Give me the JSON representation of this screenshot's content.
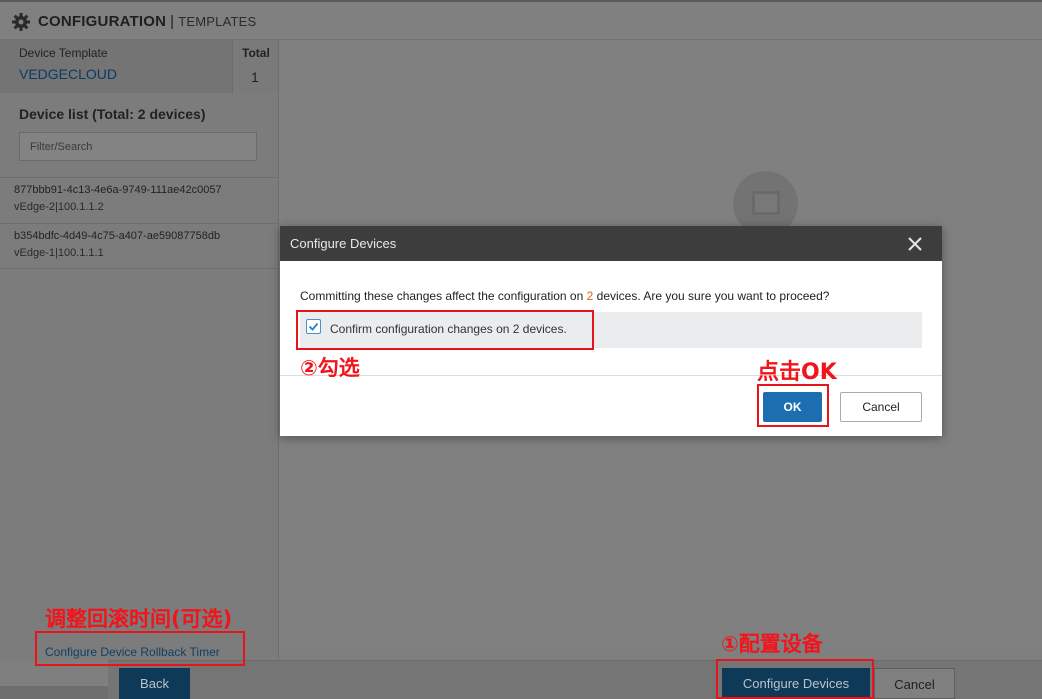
{
  "header": {
    "title": "CONFIGURATION",
    "separator": "|",
    "subtitle": "TEMPLATES",
    "icon": "gear-icon"
  },
  "left_panel": {
    "template_label": "Device Template",
    "template_name": "VEDGECLOUD",
    "total_label": "Total",
    "total_value": "1",
    "device_list_title": "Device list (Total: 2 devices)",
    "filter_placeholder": "Filter/Search",
    "devices": [
      {
        "id": "877bbb91-4c13-4e6a-9749-111ae42c0057",
        "sub": "vEdge-2|100.1.1.2"
      },
      {
        "id": "b354bdfc-4d49-4c75-a407-ae59087758db",
        "sub": "vEdge-1|100.1.1.1"
      }
    ],
    "rollback_link": "Configure Device Rollback Timer"
  },
  "footer": {
    "back_label": "Back",
    "configure_label": "Configure Devices",
    "cancel_label": "Cancel"
  },
  "modal": {
    "title": "Configure Devices",
    "message_before": "Committing these changes affect the configuration on ",
    "message_count": "2",
    "message_after": " devices. Are you sure you want to proceed?",
    "confirm_label": "Confirm configuration changes on 2 devices.",
    "confirm_checked": true,
    "ok_label": "OK",
    "cancel_label": "Cancel"
  },
  "annotations": {
    "rollback_note": "调整回滚时间(可选)",
    "configure_note": "①配置设备",
    "check_note": "②勾选",
    "ok_note": "点击OK"
  },
  "colors": {
    "annotation_red": "#e8141c",
    "primary_blue": "#1c6eb0",
    "modal_header": "#3d3d3d"
  }
}
